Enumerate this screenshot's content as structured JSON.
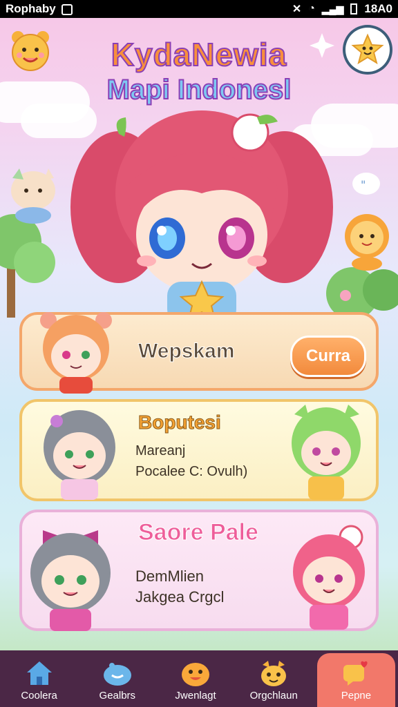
{
  "status_bar": {
    "app_name": "Rophaby",
    "time": "18A0"
  },
  "header": {
    "title_line1": "KydaNewia",
    "title_line2": "Mapi Indonesl"
  },
  "welcome_card": {
    "label": "Wepskam",
    "button": "Curra"
  },
  "card_two": {
    "title": "Boputesi",
    "line1": "Mareanj",
    "line2": "Pocalee C: Ovulh)"
  },
  "card_three": {
    "title": "Saore Pale",
    "line1": "DemMlien",
    "line2": "Jakgea Crgcl"
  },
  "nav": {
    "items": [
      {
        "label": "Coolera",
        "icon": "home-icon"
      },
      {
        "label": "Gealbrs",
        "icon": "blob-icon"
      },
      {
        "label": "Jwenlagt",
        "icon": "smiley-icon"
      },
      {
        "label": "Orgchlaun",
        "icon": "creature-icon"
      },
      {
        "label": "Pepne",
        "icon": "chat-heart-icon"
      }
    ],
    "active_index": 4
  },
  "colors": {
    "nav_bg": "#4b2746",
    "nav_active": "#f2786a",
    "accent_orange": "#f28a3c"
  }
}
